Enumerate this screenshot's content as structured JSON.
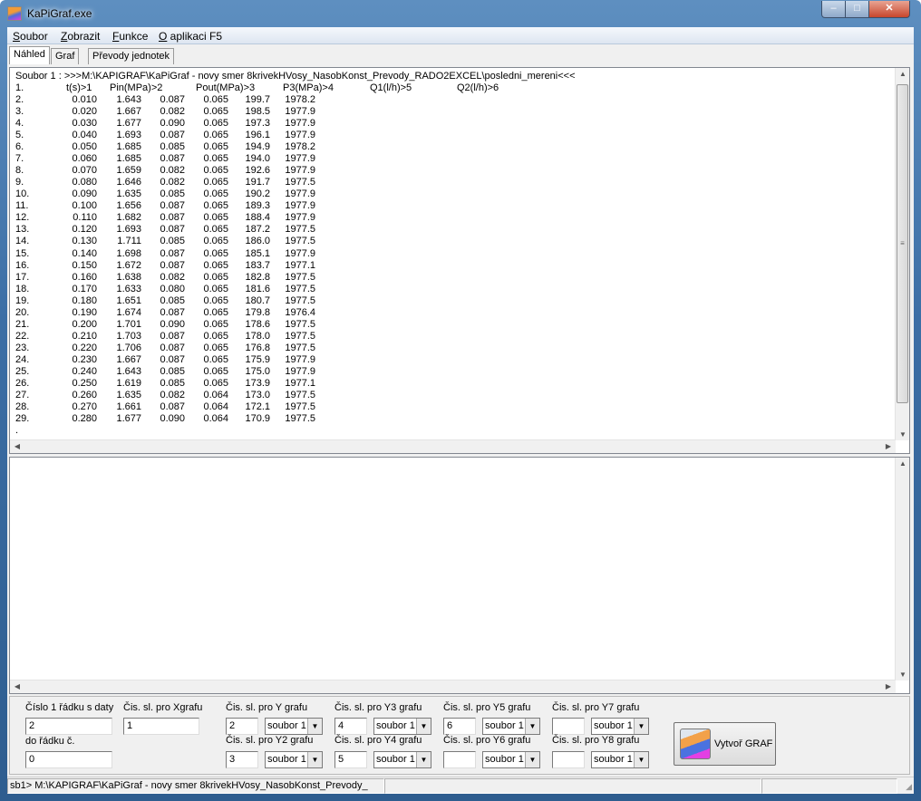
{
  "window": {
    "title": "KaPiGraf.exe",
    "min": "‒",
    "max": "□",
    "close": "✕"
  },
  "menu": [
    {
      "hot": "S",
      "rest": "oubor"
    },
    {
      "hot": "Z",
      "rest": "obrazit"
    },
    {
      "hot": "F",
      "rest": "unkce"
    },
    {
      "hot": "O",
      "rest": " aplikaci F5"
    }
  ],
  "tabs": [
    "Náhled",
    "Graf",
    "Převody jednotek"
  ],
  "preview": {
    "file_line": "Soubor 1 : >>>M:\\KAPIGRAF\\KaPiGraf - novy smer 8krivekHVosy_NasobKonst_Prevody_RADO2EXCEL\\posledni_mereni<<<",
    "header": {
      "num": "1.",
      "cols": [
        "t(s)>1",
        "Pin(MPa)>2",
        "Pout(MPa)>3",
        "P3(MPa)>4",
        "Q1(l/h)>5",
        "Q2(l/h)>6"
      ]
    },
    "rows": [
      [
        "2.",
        "0.010",
        "1.643",
        "0.087",
        "0.065",
        "199.7",
        "1978.2"
      ],
      [
        "3.",
        "0.020",
        "1.667",
        "0.082",
        "0.065",
        "198.5",
        "1977.9"
      ],
      [
        "4.",
        "0.030",
        "1.677",
        "0.090",
        "0.065",
        "197.3",
        "1977.9"
      ],
      [
        "5.",
        "0.040",
        "1.693",
        "0.087",
        "0.065",
        "196.1",
        "1977.9"
      ],
      [
        "6.",
        "0.050",
        "1.685",
        "0.085",
        "0.065",
        "194.9",
        "1978.2"
      ],
      [
        "7.",
        "0.060",
        "1.685",
        "0.087",
        "0.065",
        "194.0",
        "1977.9"
      ],
      [
        "8.",
        "0.070",
        "1.659",
        "0.082",
        "0.065",
        "192.6",
        "1977.9"
      ],
      [
        "9.",
        "0.080",
        "1.646",
        "0.082",
        "0.065",
        "191.7",
        "1977.5"
      ],
      [
        "10.",
        "0.090",
        "1.635",
        "0.085",
        "0.065",
        "190.2",
        "1977.9"
      ],
      [
        "11.",
        "0.100",
        "1.656",
        "0.087",
        "0.065",
        "189.3",
        "1977.9"
      ],
      [
        "12.",
        "0.110",
        "1.682",
        "0.087",
        "0.065",
        "188.4",
        "1977.9"
      ],
      [
        "13.",
        "0.120",
        "1.693",
        "0.087",
        "0.065",
        "187.2",
        "1977.5"
      ],
      [
        "14.",
        "0.130",
        "1.711",
        "0.085",
        "0.065",
        "186.0",
        "1977.5"
      ],
      [
        "15.",
        "0.140",
        "1.698",
        "0.087",
        "0.065",
        "185.1",
        "1977.9"
      ],
      [
        "16.",
        "0.150",
        "1.672",
        "0.087",
        "0.065",
        "183.7",
        "1977.1"
      ],
      [
        "17.",
        "0.160",
        "1.638",
        "0.082",
        "0.065",
        "182.8",
        "1977.5"
      ],
      [
        "18.",
        "0.170",
        "1.633",
        "0.080",
        "0.065",
        "181.6",
        "1977.5"
      ],
      [
        "19.",
        "0.180",
        "1.651",
        "0.085",
        "0.065",
        "180.7",
        "1977.5"
      ],
      [
        "20.",
        "0.190",
        "1.674",
        "0.087",
        "0.065",
        "179.8",
        "1976.4"
      ],
      [
        "21.",
        "0.200",
        "1.701",
        "0.090",
        "0.065",
        "178.6",
        "1977.5"
      ],
      [
        "22.",
        "0.210",
        "1.703",
        "0.087",
        "0.065",
        "178.0",
        "1977.5"
      ],
      [
        "23.",
        "0.220",
        "1.706",
        "0.087",
        "0.065",
        "176.8",
        "1977.5"
      ],
      [
        "24.",
        "0.230",
        "1.667",
        "0.087",
        "0.065",
        "175.9",
        "1977.9"
      ],
      [
        "25.",
        "0.240",
        "1.643",
        "0.085",
        "0.065",
        "175.0",
        "1977.9"
      ],
      [
        "26.",
        "0.250",
        "1.619",
        "0.085",
        "0.065",
        "173.9",
        "1977.1"
      ],
      [
        "27.",
        "0.260",
        "1.635",
        "0.082",
        "0.064",
        "173.0",
        "1977.5"
      ],
      [
        "28.",
        "0.270",
        "1.661",
        "0.087",
        "0.064",
        "172.1",
        "1977.5"
      ],
      [
        "29.",
        "0.280",
        "1.677",
        "0.090",
        "0.064",
        "170.9",
        "1977.5"
      ]
    ],
    "end_marker": "."
  },
  "controls": {
    "first_row": {
      "label": "Číslo 1 řádku s daty",
      "value": "2"
    },
    "to_row": {
      "label": "do řádku č.",
      "value": "0"
    },
    "x_col": {
      "label": "Čis. sl. pro Xgrafu",
      "value": "1"
    },
    "y": [
      {
        "label": "Čis. sl. pro Y grafu",
        "value": "2",
        "file": "soubor 1"
      },
      {
        "label": "Čis. sl. pro Y2 grafu",
        "value": "3",
        "file": "soubor 1"
      },
      {
        "label": "Čis. sl. pro Y3 grafu",
        "value": "4",
        "file": "soubor 1"
      },
      {
        "label": "Čis. sl. pro Y4 grafu",
        "value": "5",
        "file": "soubor 1"
      },
      {
        "label": "Čis. sl. pro Y5 grafu",
        "value": "6",
        "file": "soubor 1"
      },
      {
        "label": "Čis. sl. pro Y6 grafu",
        "value": "",
        "file": "soubor 1"
      },
      {
        "label": "Čis. sl. pro Y7 grafu",
        "value": "",
        "file": "soubor 1"
      },
      {
        "label": "Čis. sl. pro Y8 grafu",
        "value": "",
        "file": "soubor 1"
      }
    ],
    "create_button": "Vytvoř GRAF"
  },
  "status": {
    "path": "sb1> M:\\KAPIGRAF\\KaPiGraf - novy smer 8krivekHVosy_NasobKonst_Prevody_",
    "second": ""
  }
}
